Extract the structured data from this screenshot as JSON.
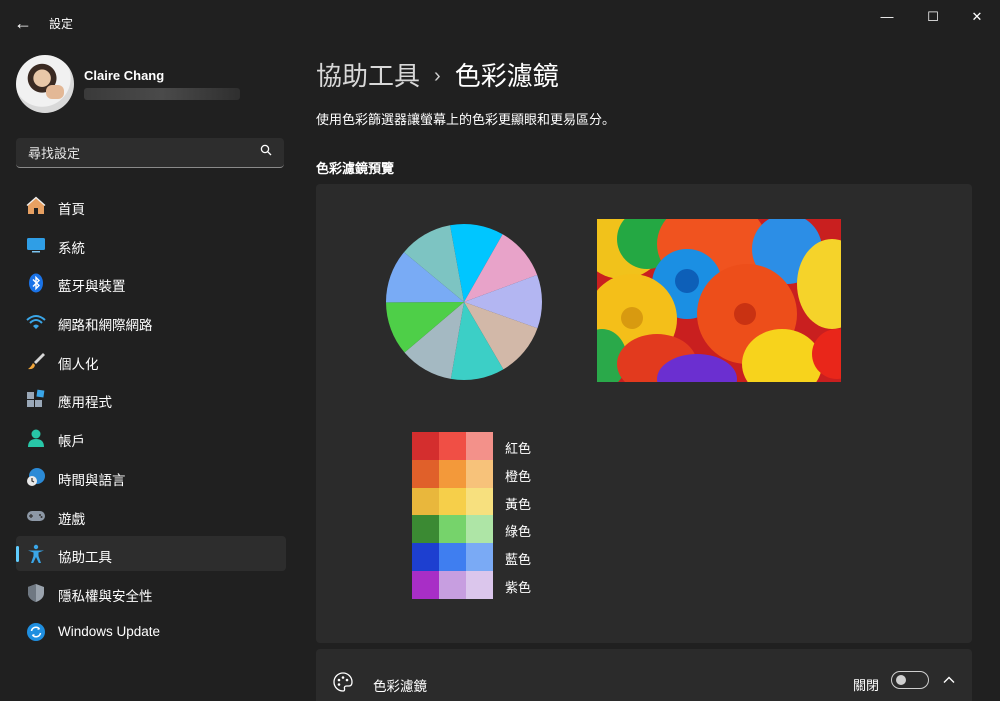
{
  "window": {
    "title": "設定",
    "back_glyph": "←",
    "min_glyph": "—",
    "max_glyph": "☐",
    "close_glyph": "✕"
  },
  "user": {
    "name": "Claire Chang"
  },
  "search": {
    "placeholder": "尋找設定"
  },
  "nav": {
    "items": [
      {
        "label": "首頁",
        "icon": "home-icon"
      },
      {
        "label": "系統",
        "icon": "monitor-icon"
      },
      {
        "label": "藍牙與裝置",
        "icon": "bluetooth-icon"
      },
      {
        "label": "網路和網際網路",
        "icon": "wifi-icon"
      },
      {
        "label": "個人化",
        "icon": "brush-icon"
      },
      {
        "label": "應用程式",
        "icon": "apps-icon"
      },
      {
        "label": "帳戶",
        "icon": "person-icon"
      },
      {
        "label": "時間與語言",
        "icon": "globe-clock-icon"
      },
      {
        "label": "遊戲",
        "icon": "gamepad-icon"
      },
      {
        "label": "協助工具",
        "icon": "accessibility-icon",
        "selected": true
      },
      {
        "label": "隱私權與安全性",
        "icon": "shield-icon"
      },
      {
        "label": "Windows Update",
        "icon": "update-icon"
      }
    ]
  },
  "page": {
    "breadcrumb_parent": "協助工具",
    "breadcrumb_sep": "›",
    "breadcrumb_current": "色彩濾鏡",
    "description": "使用色彩篩選器讓螢幕上的色彩更顯眼和更易區分。",
    "preview_title": "色彩濾鏡預覽"
  },
  "preview": {
    "pie_colors": [
      "#00c6ff",
      "#e8a3c9",
      "#b3b6f2",
      "#d2b8a8",
      "#3ccfc6",
      "#a4b9c2",
      "#4ecf48",
      "#79abf5",
      "#7dc4c2"
    ],
    "swatch_rows": [
      {
        "label": "紅色",
        "colors": [
          "#d42e2e",
          "#f04f45",
          "#f3918a"
        ]
      },
      {
        "label": "橙色",
        "colors": [
          "#e0602a",
          "#f3993a",
          "#f7c27a"
        ]
      },
      {
        "label": "黃色",
        "colors": [
          "#e9b73c",
          "#f6cf4a",
          "#f7e07e"
        ]
      },
      {
        "label": "綠色",
        "colors": [
          "#3b8a33",
          "#76d36b",
          "#aee5a6"
        ]
      },
      {
        "label": "藍色",
        "colors": [
          "#1d3fd0",
          "#3f7ef0",
          "#7aaaf5"
        ]
      },
      {
        "label": "紫色",
        "colors": [
          "#a82ec6",
          "#c79ee0",
          "#dbc6ec"
        ]
      }
    ]
  },
  "color_filter": {
    "label": "色彩濾鏡",
    "state_label": "關閉",
    "enabled": false
  },
  "colors": {
    "accent": "#60cdff",
    "background": "#202020",
    "card": "#2b2b2b"
  }
}
